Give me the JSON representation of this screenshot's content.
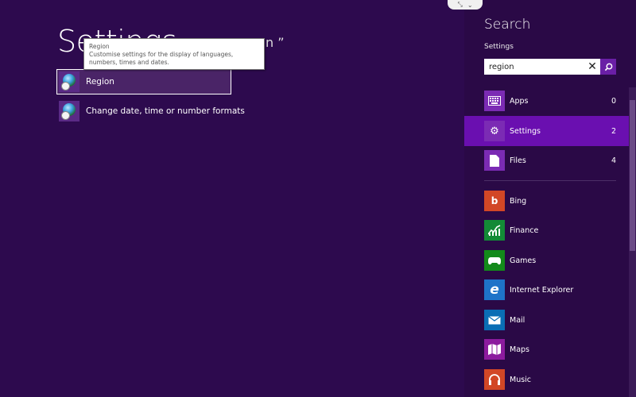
{
  "main": {
    "title": "Settings",
    "query_fragment": "n ”",
    "results": [
      {
        "label": "Region",
        "icon": "region-globe-icon",
        "selected": true
      },
      {
        "label": "Change date, time or number formats",
        "icon": "region-globe-icon",
        "selected": false
      }
    ],
    "tooltip": {
      "title": "Region",
      "description": "Customise settings for the display of languages, numbers, times and dates."
    }
  },
  "pane": {
    "title": "Search",
    "scope_label": "Settings",
    "search": {
      "value": "region",
      "placeholder": ""
    },
    "grip_icons": [
      "collapse-arrows-icon",
      "chevron-down-icon"
    ],
    "scopes": [
      {
        "label": "Apps",
        "count": "0",
        "icon": "keyboard-icon"
      },
      {
        "label": "Settings",
        "count": "2",
        "icon": "gear-icon",
        "active": true
      },
      {
        "label": "Files",
        "count": "4",
        "icon": "file-icon"
      }
    ],
    "apps": [
      {
        "label": "Bing",
        "icon": "bing-icon",
        "color": "#d24726"
      },
      {
        "label": "Finance",
        "icon": "finance-chart-icon",
        "color": "#138a36"
      },
      {
        "label": "Games",
        "icon": "gamepad-icon",
        "color": "#138a1a"
      },
      {
        "label": "Internet Explorer",
        "icon": "internet-explorer-icon",
        "color": "#1e73c8"
      },
      {
        "label": "Mail",
        "icon": "mail-icon",
        "color": "#0a6eb5"
      },
      {
        "label": "Maps",
        "icon": "map-icon",
        "color": "#8c1b9e"
      },
      {
        "label": "Music",
        "icon": "headphones-icon",
        "color": "#d24726"
      }
    ]
  },
  "colors": {
    "background": "#2d0a4e",
    "pane_background": "#2a0946",
    "accent": "#6a0fb0"
  }
}
